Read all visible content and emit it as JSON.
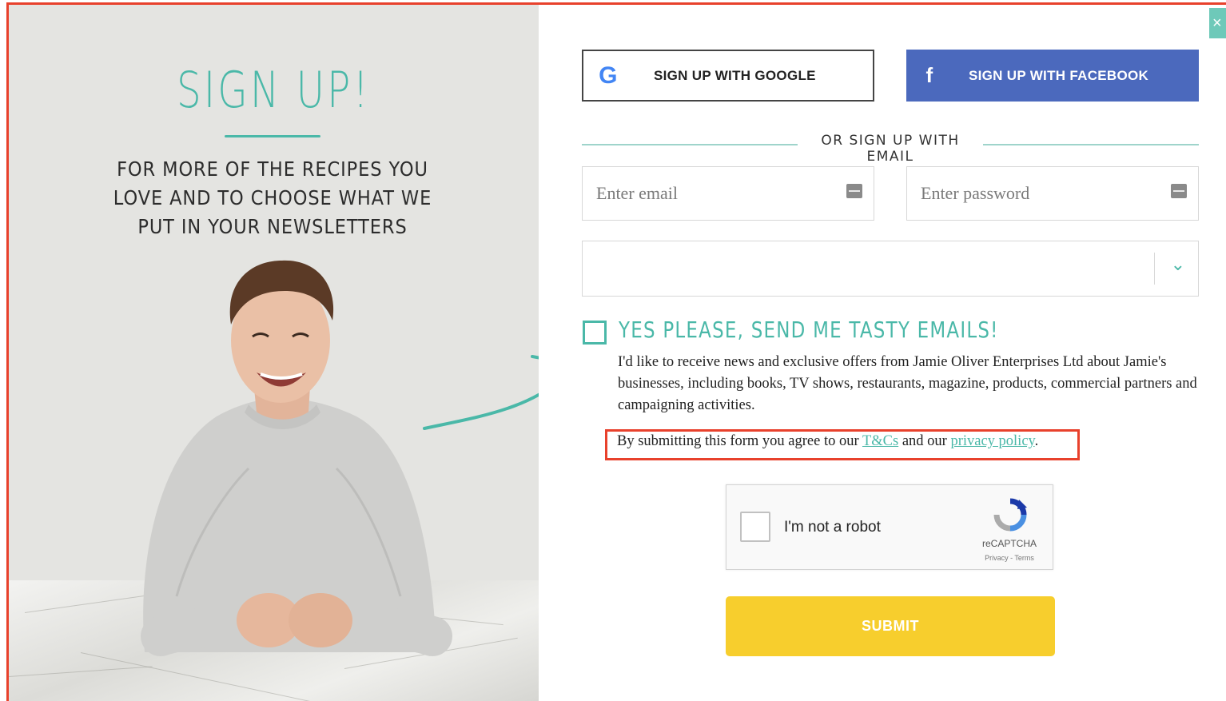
{
  "left_panel": {
    "title": "SIGN UP!",
    "subtitle": "FOR MORE OF THE RECIPES YOU LOVE AND TO CHOOSE WHAT WE PUT IN YOUR NEWSLETTERS"
  },
  "social": {
    "google_label": "SIGN UP WITH GOOGLE",
    "google_glyph": "G",
    "facebook_label": "SIGN UP WITH FACEBOOK",
    "facebook_glyph": "f"
  },
  "divider": "OR SIGN UP WITH EMAIL",
  "form": {
    "email_placeholder": "Enter email",
    "password_placeholder": "Enter password",
    "select_value": "",
    "consent_title": "YES PLEASE, SEND ME TASTY EMAILS!",
    "consent_body": "I'd like to receive news and exclusive offers from Jamie Oliver Enterprises Ltd about Jamie's businesses, including books, TV shows, restaurants, magazine, products, commercial partners and campaigning activities.",
    "terms_prefix": "By submitting this form you agree to our ",
    "terms_link": "T&Cs",
    "terms_middle": " and our ",
    "privacy_link": "privacy policy",
    "terms_suffix": ".",
    "submit_label": "SUBMIT"
  },
  "captcha": {
    "label": "I'm not a robot",
    "brand": "reCAPTCHA",
    "links": "Privacy - Terms"
  },
  "close_glyph": "×",
  "colors": {
    "accent": "#4ab8a8",
    "facebook": "#4b69bd",
    "submit": "#f7ce2d",
    "highlight": "#e8412c"
  }
}
